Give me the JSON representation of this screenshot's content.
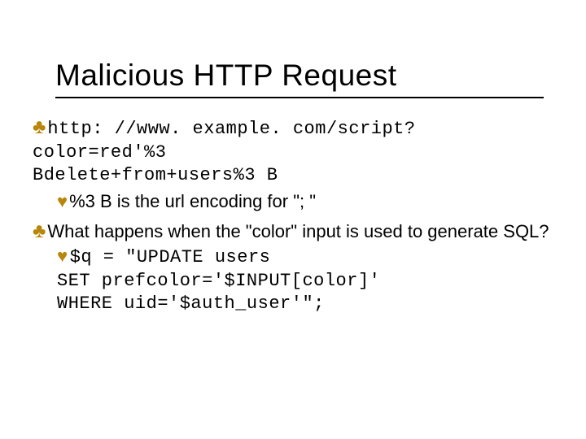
{
  "title": "Malicious HTTP Request",
  "b1_url_part1": "http: //www. example. com/script? color=red'%3",
  "b1_url_part2": "Bdelete+from+users%3 B",
  "b1_sub": "%3 B is the url encoding for \"; \"",
  "b2_text": "What happens when the \"color\" input is used to generate SQL?",
  "code_l1": "$q = \"UPDATE users",
  "code_l2": "SET prefcolor='$INPUT[color]'",
  "code_l3": "WHERE uid='$auth_user'\";"
}
